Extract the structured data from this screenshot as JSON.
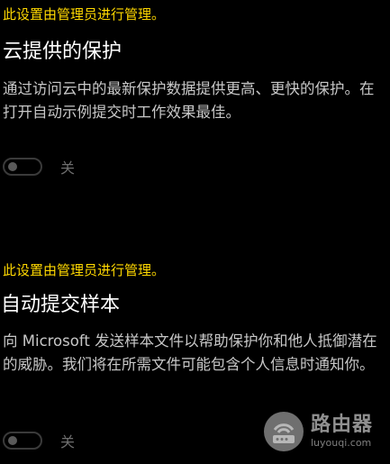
{
  "cloud_protection": {
    "managed_note": "此设置由管理员进行管理。",
    "title": "云提供的保护",
    "description": "通过访问云中的最新保护数据提供更高、更快的保护。在打开自动示例提交时工作效果最佳。",
    "toggle_state": "关"
  },
  "sample_submission": {
    "managed_note": "此设置由管理员进行管理。",
    "title": "自动提交样本",
    "description": "向 Microsoft 发送样本文件以帮助保护你和他人抵御潜在的威胁。我们将在所需文件可能包含个人信息时通知你。",
    "toggle_state": "关"
  },
  "watermark": {
    "brand": "路由器",
    "url": "luyouqi.com",
    "icon": "router-logo-icon"
  },
  "colors": {
    "background": "#000000",
    "managed_note": "#ffd800",
    "title": "#ffffff",
    "description": "#c8c8c8",
    "toggle_off": "#5a5a5a"
  }
}
